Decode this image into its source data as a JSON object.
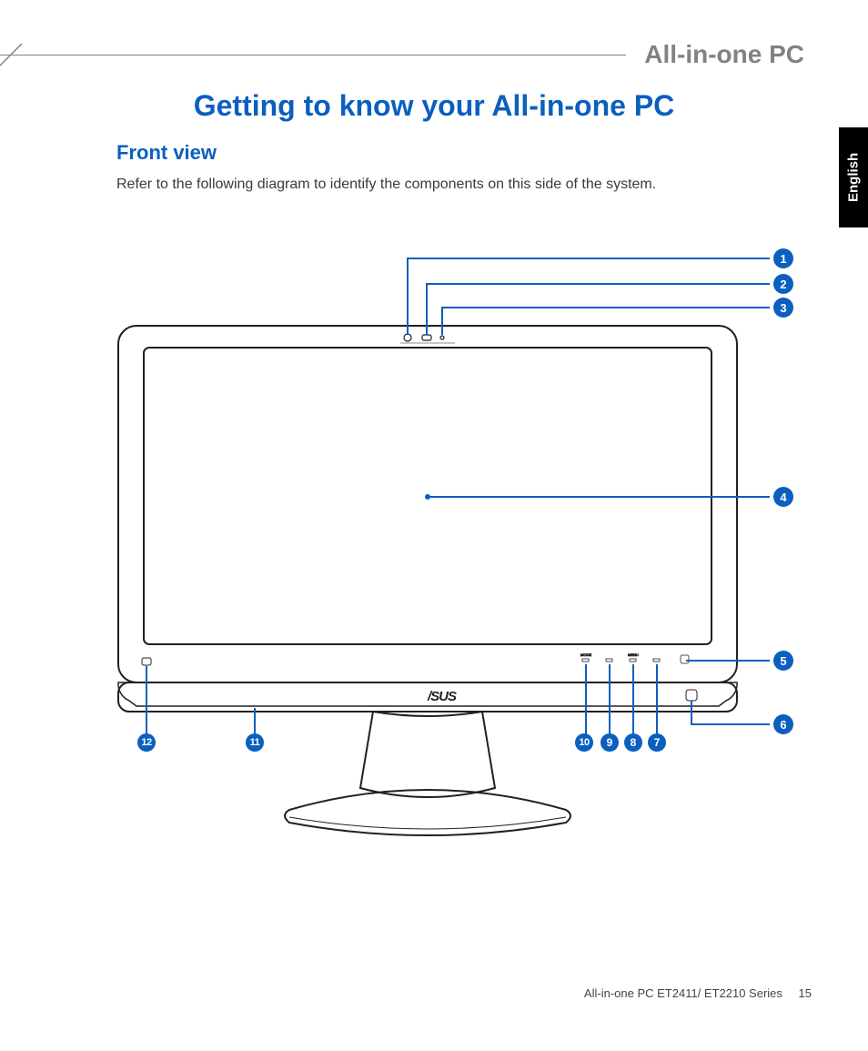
{
  "header": {
    "brand": "All-in-one PC"
  },
  "language_tab": "English",
  "title": "Getting to know your All-in-one PC",
  "section": "Front view",
  "description": "Refer to the following diagram to identify the components on this side of the system.",
  "diagram": {
    "device_brand_logo_text": "/SUS",
    "button_labels": [
      "MODE",
      "",
      "MENU",
      ""
    ],
    "callouts": [
      "1",
      "2",
      "3",
      "4",
      "5",
      "6",
      "7",
      "8",
      "9",
      "10",
      "11",
      "12"
    ]
  },
  "footer": {
    "model": "All-in-one PC ET2411/ ET2210 Series",
    "page_number": "15"
  }
}
